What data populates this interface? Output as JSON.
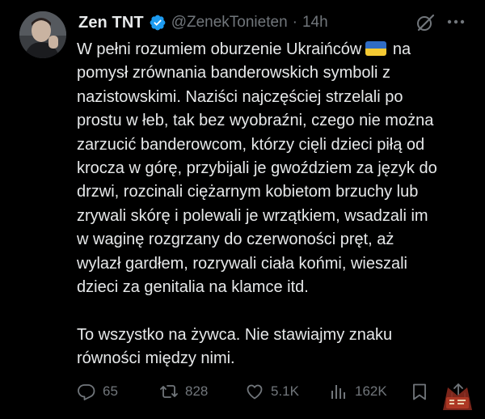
{
  "author": {
    "display_name": "Zen TNT",
    "handle": "@ZenekTonieten",
    "separator": "·",
    "time": "14h",
    "verified": true
  },
  "tweet_lines": [
    "W pełni rozumiem oburzenie Ukraińców",
    "pomysł zrównania banderowskich symboli z",
    "nazistowskimi. Naziści najczęściej strzelali po",
    "prostu w łeb, tak bez wyobraźni, czego nie można",
    "zarzucić banderowcom, którzy cięli dzieci piłą od",
    "krocza w górę, przybijali je gwoździem za język do",
    "drzwi, rozcinali ciężarnym kobietom brzuchy lub",
    "zrywali skórę i polewali je wrzątkiem, wsadzali im",
    "w waginę rozgrzany do czerwoności pręt, aż",
    "wylazł gardłem, rozrywali ciała końmi, wieszali",
    "dzieci za genitalia na klamce itd.",
    "To wszystko na żywca. Nie stawiajmy znaku",
    "równości między nimi."
  ],
  "tweet_first_line_tail": "na",
  "actions": {
    "replies": "65",
    "retweets": "828",
    "likes": "5.1K",
    "views": "162K"
  },
  "icons": {
    "verified": "verified-badge-icon",
    "grok": "grok-icon",
    "more": "more-options-icon",
    "reply": "reply-icon",
    "retweet": "retweet-icon",
    "like": "heart-icon",
    "views": "views-chart-icon",
    "bookmark": "bookmark-icon",
    "share": "share-icon",
    "flag": "ukraine-flag-emoji"
  },
  "colors": {
    "background": "#000000",
    "text": "#e7e9ea",
    "muted": "#71767b",
    "verified_blue": "#1d9bf0",
    "flag_blue": "#2f6cc4",
    "flag_yellow": "#f4c933"
  }
}
